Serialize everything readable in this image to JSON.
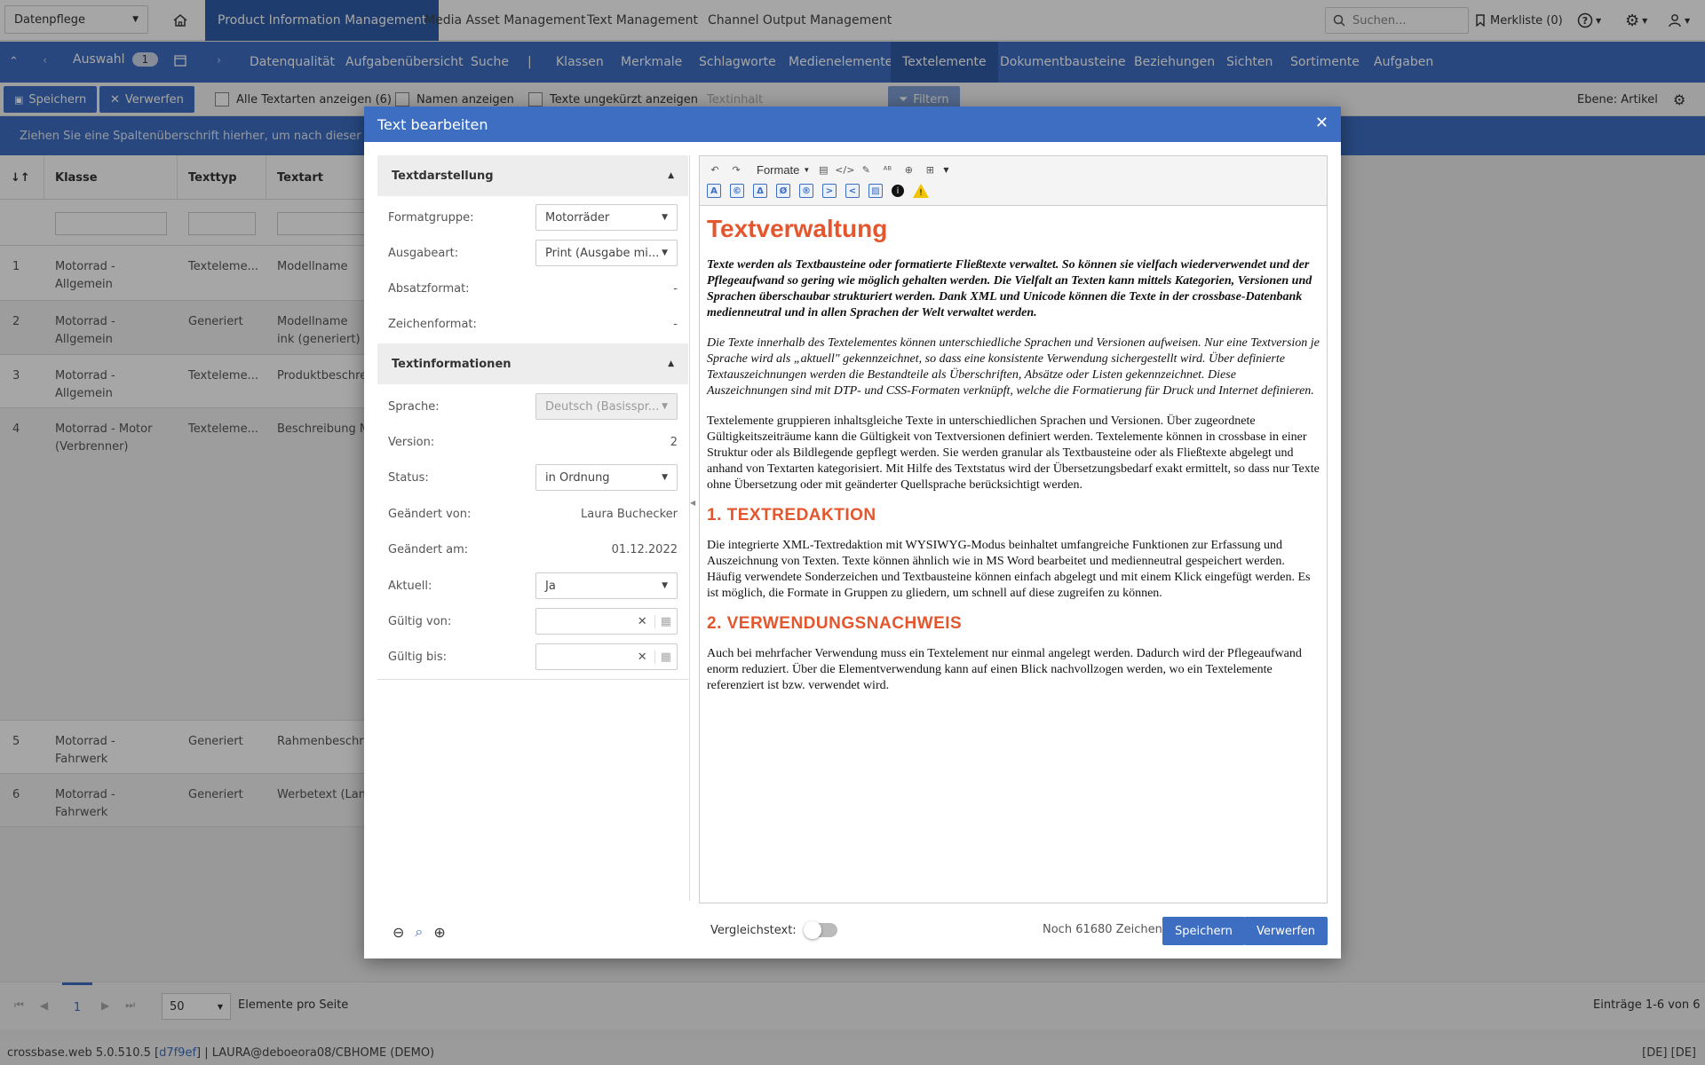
{
  "topbar": {
    "workspace": "Datenpflege",
    "tabs": [
      "Product Information Management",
      "Media Asset Management",
      "Text Management",
      "Channel Output Management"
    ],
    "search_placeholder": "Suchen...",
    "merkliste": "Merkliste (0)"
  },
  "navbar": {
    "auswahl": "Auswahl",
    "auswahl_count": "1",
    "items": [
      "Datenqualität",
      "Aufgabenübersicht",
      "Suche",
      "|",
      "Klassen",
      "Merkmale",
      "Schlagworte",
      "Medienelemente",
      "Textelemente",
      "Dokumentbausteine",
      "Beziehungen",
      "Sichten",
      "Sortimente",
      "Aufgaben"
    ]
  },
  "toolbar": {
    "save": "Speichern",
    "discard": "Verwerfen",
    "show_all": "Alle Textarten anzeigen (6)",
    "show_names": "Namen anzeigen",
    "show_full": "Texte ungekürzt anzeigen",
    "text_placeholder": "Textinhalt",
    "filter": "Filtern",
    "level": "Ebene: Artikel"
  },
  "groupbar": "Ziehen Sie eine Spaltenüberschrift hierher, um nach dieser Spalte",
  "grid": {
    "headers": [
      "Klasse",
      "Texttyp",
      "Textart"
    ],
    "rows": [
      {
        "n": "1",
        "klasse": "Motorrad - Allgemein",
        "typ": "Texteleme...",
        "art": "Modellname"
      },
      {
        "n": "2",
        "klasse": "Motorrad - Allgemein",
        "typ": "Generiert",
        "art": "Modellname ink (generiert)"
      },
      {
        "n": "3",
        "klasse": "Motorrad - Allgemein",
        "typ": "Texteleme...",
        "art": "Produktbeschre"
      },
      {
        "n": "4",
        "klasse": "Motorrad - Motor (Verbrenner)",
        "typ": "Texteleme...",
        "art": "Beschreibung M"
      },
      {
        "n": "5",
        "klasse": "Motorrad - Fahrwerk",
        "typ": "Generiert",
        "art": "Rahmenbeschre"
      },
      {
        "n": "6",
        "klasse": "Motorrad - Fahrwerk",
        "typ": "Generiert",
        "art": "Werbetext (Lang"
      }
    ]
  },
  "pager": {
    "page": "1",
    "page_size": "50",
    "per_page_label": "Elemente pro Seite",
    "entries": "Einträge 1-6 von 6"
  },
  "statusbar": {
    "version_prefix": "crossbase.web 5.0.510.5 [",
    "commit": "d7f9ef",
    "version_suffix": "] | LAURA@deboeora08/CBHOME (DEMO)",
    "lang": "[DE] [DE]"
  },
  "dialog": {
    "title": "Text bearbeiten",
    "sect1": "Textdarstellung",
    "sect2": "Textinformationen",
    "fields": {
      "formatgruppe_label": "Formatgruppe:",
      "formatgruppe": "Motorräder",
      "ausgabeart_label": "Ausgabeart:",
      "ausgabeart": "Print (Ausgabe mi...",
      "absatz_label": "Absatzformat:",
      "absatz": "-",
      "zeichen_label": "Zeichenformat:",
      "zeichen": "-",
      "sprache_label": "Sprache:",
      "sprache": "Deutsch (Basisspr...",
      "version_label": "Version:",
      "version": "2",
      "status_label": "Status:",
      "status": "in Ordnung",
      "geaendert_von_label": "Geändert von:",
      "geaendert_von": "Laura Buchecker",
      "geaendert_am_label": "Geändert am:",
      "geaendert_am": "01.12.2022",
      "aktuell_label": "Aktuell:",
      "aktuell": "Ja",
      "gueltig_von_label": "Gültig von:",
      "gueltig_bis_label": "Gültig bis:"
    },
    "editor": {
      "formats": "Formate",
      "heading": "Textverwaltung",
      "p1": "Texte werden als Textbausteine oder formatierte Fließtexte verwaltet. So können sie vielfach wiederverwendet und der Pflegeaufwand so gering wie möglich gehalten werden. Die Vielfalt an Texten kann mittels Kategorien, Versionen und Sprachen überschaubar strukturiert werden. Dank XML und Unicode können die Texte in der crossbase-Datenbank medienneutral und in allen Sprachen der Welt verwaltet werden.",
      "p2": "Die Texte innerhalb des Textelementes können unterschiedliche Sprachen und Versionen aufweisen. Nur eine Textversion je Sprache wird als „aktuell\" gekennzeichnet, so dass eine konsistente Verwendung sichergestellt wird. Über definierte Textauszeichnungen werden die Bestandteile als Überschriften, Absätze oder Listen gekennzeichnet. Diese Auszeichnungen sind mit DTP- und CSS-Formaten verknüpft, welche die Formatierung für Druck und Internet definieren.",
      "p3": "Textelemente gruppieren inhaltsgleiche Texte in unterschiedlichen Sprachen und Versionen. Über zugeordnete Gültigkeitszeiträume kann die Gültigkeit von Textversionen definiert werden. Textelemente können in crossbase in einer Struktur oder als Bildlegende gepflegt werden. Sie werden granular als Textbausteine oder als Fließtexte abgelegt und anhand von Textarten kategorisiert. Mit Hilfe des Textstatus wird der Übersetzungsbedarf exakt ermittelt, so dass nur Texte ohne Übersetzung oder mit geänderter Quellsprache berücksichtigt werden.",
      "h2a": "1.  TEXTREDAKTION",
      "p4": "Die integrierte XML-Textredaktion mit WYSIWYG-Modus beinhaltet umfangreiche Funktionen zur Erfassung und Auszeichnung von Texten. Texte können ähnlich wie in MS Word bearbeitet und medienneutral gespeichert werden. Häufig verwendete Sonderzeichen und Textbausteine können einfach abgelegt und mit einem Klick eingefügt werden. Es ist möglich, die Formate in Gruppen zu gliedern, um schnell auf diese zugreifen zu können.",
      "h2b": "2.  VERWENDUNGSNACHWEIS",
      "p5": "Auch bei mehrfacher Verwendung muss ein Textelement nur einmal angelegt werden. Dadurch wird der Pflegeaufwand enorm reduziert. Über die Elementverwendung kann auf einen Blick nachvollzogen werden, wo ein Textelemente referenziert ist bzw. verwendet wird."
    },
    "footer": {
      "compare_label": "Vergleichstext:",
      "remaining": "Noch 61680 Zeichen",
      "save": "Speichern",
      "discard": "Verwerfen"
    }
  },
  "colors": {
    "brand": "#3d6ec2",
    "heading": "#e4572e"
  }
}
